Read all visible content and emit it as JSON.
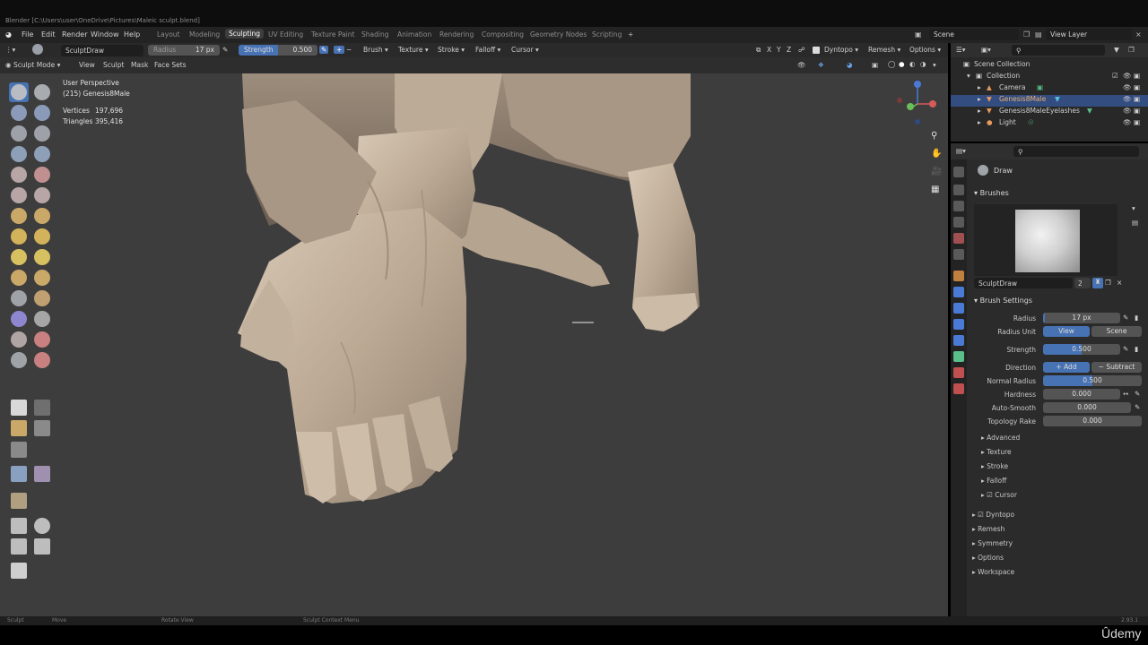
{
  "window": {
    "title": "Blender [C:\\Users\\user\\OneDrive\\Pictures\\Maleic sculpt.blend]"
  },
  "menu": {
    "file": "File",
    "edit": "Edit",
    "render": "Render",
    "window": "Window",
    "help": "Help"
  },
  "workspaces": [
    "Layout",
    "Modeling",
    "Sculpting",
    "UV Editing",
    "Texture Paint",
    "Shading",
    "Animation",
    "Rendering",
    "Compositing",
    "Geometry Nodes",
    "Scripting"
  ],
  "active_workspace_index": 2,
  "scene": {
    "label": "Scene"
  },
  "view_layer": {
    "label": "View Layer"
  },
  "tool_header": {
    "brush_name": "SculptDraw",
    "radius_label": "Radius",
    "radius_value": "17 px",
    "strength_label": "Strength",
    "strength_value": "0.500",
    "strength_fraction": 0.5,
    "brush_menu": "Brush",
    "texture_menu": "Texture",
    "stroke_menu": "Stroke",
    "falloff_menu": "Falloff",
    "cursor_menu": "Cursor",
    "axes": [
      "X",
      "Y",
      "Z"
    ],
    "dyntopo": "Dyntopo",
    "remesh": "Remesh",
    "options": "Options"
  },
  "mode_header": {
    "mode": "Sculpt Mode",
    "view": "View",
    "sculpt": "Sculpt",
    "mask": "Mask",
    "face_sets": "Face Sets"
  },
  "viewport": {
    "perspective": "User Perspective",
    "object": "(215) Genesis8Male",
    "vertices_label": "Vertices",
    "vertices_value": "197,696",
    "triangles_label": "Triangles",
    "triangles_value": "395,416"
  },
  "outliner": {
    "root": "Scene Collection",
    "collection": "Collection",
    "items": [
      "Camera",
      "Genesis8Male",
      "Genesis8MaleEyelashes",
      "Light"
    ]
  },
  "properties": {
    "tool_name": "Draw",
    "brushes_panel": "Brushes",
    "brush_field": "SculptDraw",
    "brush_users": "2",
    "brush_settings_panel": "Brush Settings",
    "radius_label": "Radius",
    "radius_value": "17 px",
    "radius_unit_label": "Radius Unit",
    "radius_unit_view": "View",
    "radius_unit_scene": "Scene",
    "strength_label": "Strength",
    "strength_value": "0.500",
    "strength_fraction": 0.5,
    "direction_label": "Direction",
    "direction_add": "Add",
    "direction_subtract": "Subtract",
    "normal_radius_label": "Normal Radius",
    "normal_radius_value": "0.500",
    "normal_radius_fraction": 0.5,
    "hardness_label": "Hardness",
    "hardness_value": "0.000",
    "auto_smooth_label": "Auto-Smooth",
    "auto_smooth_value": "0.000",
    "topology_rake_label": "Topology Rake",
    "topology_rake_value": "0.000",
    "subpanels": [
      "Advanced",
      "Texture",
      "Stroke",
      "Falloff",
      "Cursor"
    ],
    "panels": [
      "Dyntopo",
      "Remesh",
      "Symmetry",
      "Options",
      "Workspace"
    ]
  },
  "status_bar": {
    "left1": "Sculpt",
    "left2": "Move",
    "mid": "Rotate View",
    "right": "Sculpt Context Menu",
    "version": "2.93.1"
  },
  "watermark": "Ûdemy",
  "colors": {
    "accent_blue": "#4772b3",
    "selected_row": "#334d80",
    "viewport_bg": "#3d3d3d",
    "skin": "#c8b8a5"
  }
}
